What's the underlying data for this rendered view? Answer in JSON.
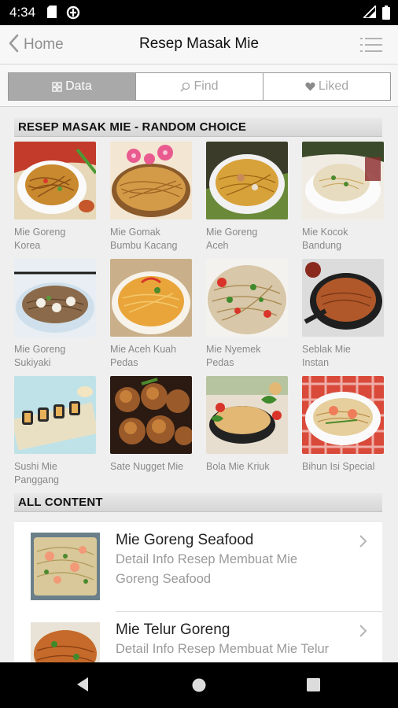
{
  "status_bar": {
    "time": "4:34",
    "icons": [
      "sim-card-icon",
      "data-saver-icon",
      "signal-icon",
      "battery-icon"
    ]
  },
  "nav": {
    "back_label": "Home",
    "title": "Resep Masak Mie",
    "back_icon": "chevron-left-icon",
    "menu_icon": "list-menu-icon"
  },
  "tabs": [
    {
      "label": "Data",
      "icon": "grid-icon",
      "active": true
    },
    {
      "label": "Find",
      "icon": "search-icon",
      "active": false
    },
    {
      "label": "Liked",
      "icon": "heart-icon",
      "active": false
    }
  ],
  "random_section": {
    "title": "RESEP MASAK MIE - RANDOM CHOICE",
    "items": [
      {
        "line1": "Mie Goreng",
        "line2": "Korea"
      },
      {
        "line1": "Mie Gomak",
        "line2": "Bumbu Kacang"
      },
      {
        "line1": "Mie Goreng",
        "line2": "Aceh"
      },
      {
        "line1": "Mie Kocok",
        "line2": "Bandung"
      },
      {
        "line1": "Mie Goreng",
        "line2": "Sukiyaki"
      },
      {
        "line1": "Mie Aceh Kuah",
        "line2": "Pedas"
      },
      {
        "line1": "Mie Nyemek",
        "line2": "Pedas"
      },
      {
        "line1": "Seblak Mie",
        "line2": "Instan"
      },
      {
        "line1": "Sushi Mie",
        "line2": "Panggang"
      },
      {
        "line1": "Sate Nugget Mie",
        "line2": ""
      },
      {
        "line1": "Bola Mie Kriuk",
        "line2": ""
      },
      {
        "line1": "Bihun Isi Special",
        "line2": ""
      }
    ]
  },
  "all_section": {
    "title": "ALL CONTENT",
    "items": [
      {
        "title": "Mie Goreng Seafood",
        "desc1": "Detail Info Resep Membuat Mie",
        "desc2": "Goreng Seafood"
      },
      {
        "title": "Mie Telur Goreng",
        "desc1": "Detail Info Resep Membuat Mie Telur",
        "desc2": ""
      }
    ]
  },
  "system_nav": {
    "icons": [
      "back-triangle-icon",
      "home-circle-icon",
      "recents-square-icon"
    ]
  },
  "colors": {
    "active_tab": "#a9a9a9",
    "background": "#efefef",
    "header_gradient_top": "#e9e9e9",
    "header_gradient_bottom": "#d6d6d6"
  }
}
